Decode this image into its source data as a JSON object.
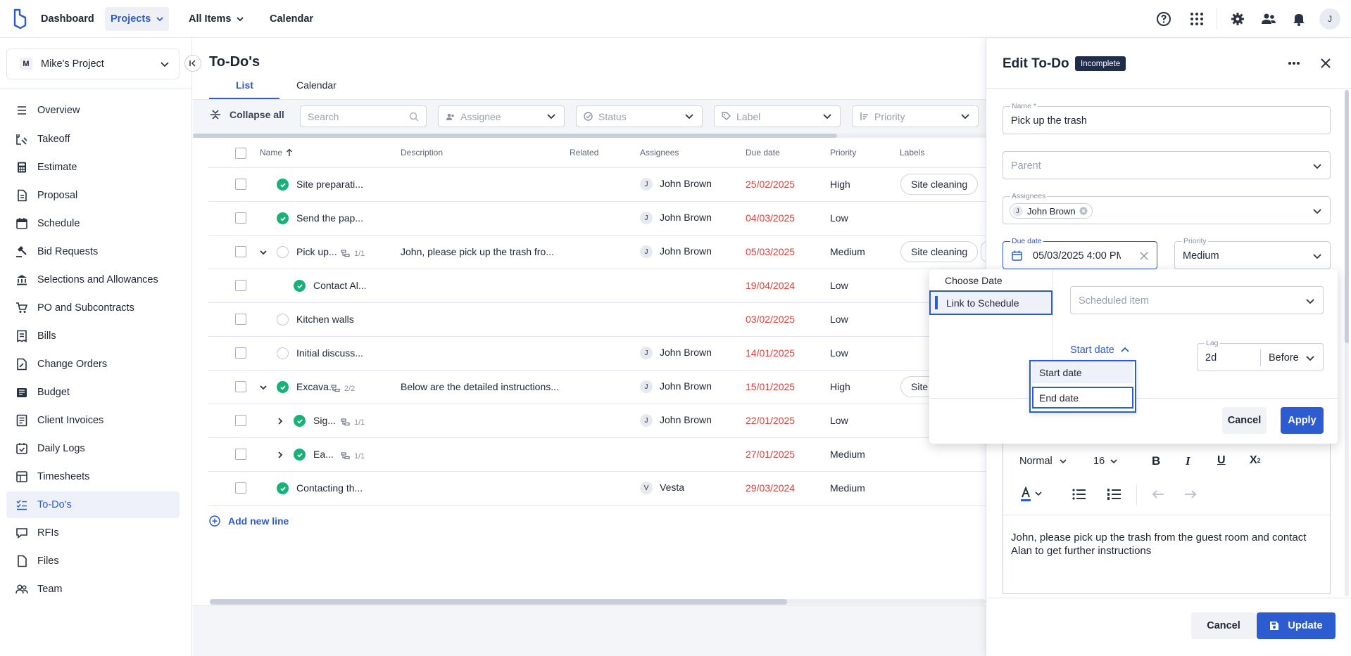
{
  "topbar": {
    "nav": [
      {
        "label": "Dashboard"
      },
      {
        "label": "Projects"
      },
      {
        "label": "All Items"
      },
      {
        "label": "Calendar"
      }
    ],
    "avatar": "J"
  },
  "sidebar": {
    "project": {
      "badge": "M",
      "name": "Mike's Project"
    },
    "items": [
      {
        "label": "Overview",
        "icon": "list-icon"
      },
      {
        "label": "Takeoff",
        "icon": "ruler-icon"
      },
      {
        "label": "Estimate",
        "icon": "calculator-icon"
      },
      {
        "label": "Proposal",
        "icon": "document-icon"
      },
      {
        "label": "Schedule",
        "icon": "calendar-icon"
      },
      {
        "label": "Bid Requests",
        "icon": "gavel-icon"
      },
      {
        "label": "Selections and Allowances",
        "icon": "bank-icon"
      },
      {
        "label": "PO and Subcontracts",
        "icon": "cart-icon"
      },
      {
        "label": "Bills",
        "icon": "receipt-icon"
      },
      {
        "label": "Change Orders",
        "icon": "file-edit-icon"
      },
      {
        "label": "Budget",
        "icon": "wallet-icon"
      },
      {
        "label": "Client Invoices",
        "icon": "invoice-icon"
      },
      {
        "label": "Daily Logs",
        "icon": "calendar-check-icon"
      },
      {
        "label": "Timesheets",
        "icon": "timesheet-icon"
      },
      {
        "label": "To-Do's",
        "icon": "checklist-icon"
      },
      {
        "label": "RFIs",
        "icon": "chat-icon"
      },
      {
        "label": "Files",
        "icon": "file-icon"
      },
      {
        "label": "Team",
        "icon": "team-icon"
      }
    ]
  },
  "main": {
    "title": "To-Do's",
    "tabs": [
      {
        "label": "List"
      },
      {
        "label": "Calendar"
      }
    ],
    "toolbar": {
      "collapse_all": "Collapse all",
      "search_placeholder": "Search",
      "filters": [
        "Assignee",
        "Status",
        "Label",
        "Priority"
      ]
    },
    "columns": [
      "Name",
      "Description",
      "Related",
      "Assignees",
      "Due date",
      "Priority",
      "Labels"
    ],
    "rows": [
      {
        "name": "Site preparati...",
        "description": "",
        "assignee": "John Brown",
        "assignee_initial": "J",
        "due": "25/02/2025",
        "priority": "High",
        "label": "Site cleaning",
        "status": "done",
        "subcount": ""
      },
      {
        "name": "Send the pap...",
        "description": "",
        "assignee": "John Brown",
        "assignee_initial": "J",
        "due": "04/03/2025",
        "priority": "Low",
        "label": "",
        "status": "done",
        "subcount": ""
      },
      {
        "name": "Pick up...",
        "description": "John, please pick up the trash fro...",
        "assignee": "John Brown",
        "assignee_initial": "J",
        "due": "05/03/2025",
        "priority": "Medium",
        "label": "Site cleaning",
        "status": "open",
        "subcount": "1/1"
      },
      {
        "name": "Contact Al...",
        "description": "",
        "assignee": "",
        "assignee_initial": "",
        "due": "19/04/2024",
        "priority": "Low",
        "label": "",
        "status": "done",
        "subcount": ""
      },
      {
        "name": "Kitchen walls",
        "description": "",
        "assignee": "",
        "assignee_initial": "",
        "due": "03/02/2025",
        "priority": "Low",
        "label": "",
        "status": "open",
        "subcount": ""
      },
      {
        "name": "Initial discuss...",
        "description": "",
        "assignee": "John Brown",
        "assignee_initial": "J",
        "due": "14/01/2025",
        "priority": "Low",
        "label": "",
        "status": "open",
        "subcount": ""
      },
      {
        "name": "Excava...",
        "description": "Below are the detailed instructions...",
        "assignee": "John Brown",
        "assignee_initial": "J",
        "due": "15/01/2025",
        "priority": "High",
        "label": "Site",
        "status": "done",
        "subcount": "2/2"
      },
      {
        "name": "Sig...",
        "description": "",
        "assignee": "John Brown",
        "assignee_initial": "J",
        "due": "22/01/2025",
        "priority": "Low",
        "label": "",
        "status": "done",
        "subcount": "1/1"
      },
      {
        "name": "Ea...",
        "description": "",
        "assignee": "",
        "assignee_initial": "",
        "due": "27/01/2025",
        "priority": "Medium",
        "label": "",
        "status": "done",
        "subcount": "1/1"
      },
      {
        "name": "Contacting th...",
        "description": "",
        "assignee": "Vesta",
        "assignee_initial": "V",
        "due": "29/03/2024",
        "priority": "Medium",
        "label": "",
        "status": "done",
        "subcount": ""
      }
    ],
    "add_line": "Add new line"
  },
  "drawer": {
    "title": "Edit To-Do",
    "badge": "Incomplete",
    "name_label": "Name *",
    "name_value": "Pick up the trash",
    "parent_placeholder": "Parent",
    "assignees_label": "Assignees",
    "assignee_chip": "John Brown",
    "assignee_initial": "J",
    "due_label": "Due date",
    "due_value": "05/03/2025 4:00 PM",
    "priority_label": "Priority",
    "priority_value": "Medium",
    "editor": {
      "format": "Normal",
      "size": "16",
      "text": "John, please pick up the trash from the guest room and contact Alan to get further instructions"
    },
    "cancel": "Cancel",
    "update": "Update"
  },
  "popover": {
    "options": [
      "Choose Date",
      "Link to Schedule"
    ],
    "scheduled_placeholder": "Scheduled item",
    "anchor": "Start date",
    "lag_label": "Lag",
    "lag_value": "2d",
    "direction": "Before",
    "menu": [
      "Start date",
      "End date"
    ],
    "cancel": "Cancel",
    "apply": "Apply"
  },
  "colors": {
    "accent": "#2d5bd0",
    "done": "#19b07a",
    "overdue": "#e0403c"
  }
}
